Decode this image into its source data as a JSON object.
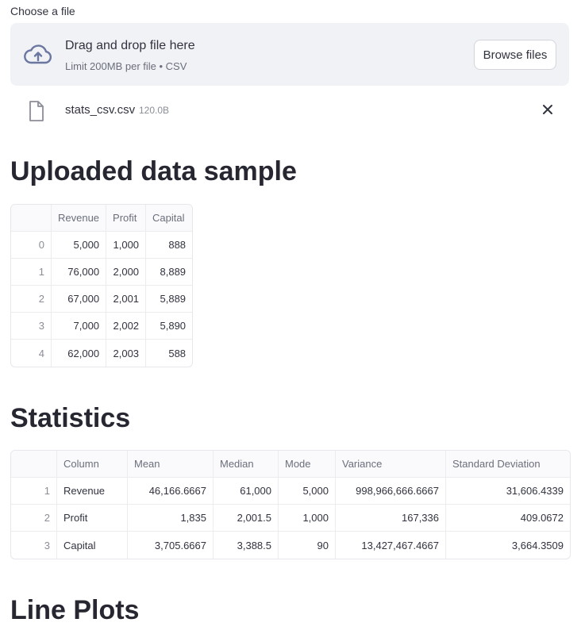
{
  "uploader": {
    "label": "Choose a file",
    "dropzone_title": "Drag and drop file here",
    "dropzone_subtitle": "Limit 200MB per file • CSV",
    "browse_label": "Browse files",
    "icon": "cloud-upload-icon"
  },
  "file": {
    "name": "stats_csv.csv",
    "size": "120.0B",
    "icon": "file-icon",
    "remove_icon": "close-icon"
  },
  "sample": {
    "heading": "Uploaded data sample",
    "columns": [
      "Revenue",
      "Profit",
      "Capital"
    ],
    "rows": [
      {
        "index": "0",
        "cells": [
          "5,000",
          "1,000",
          "888"
        ]
      },
      {
        "index": "1",
        "cells": [
          "76,000",
          "2,000",
          "8,889"
        ]
      },
      {
        "index": "2",
        "cells": [
          "67,000",
          "2,001",
          "5,889"
        ]
      },
      {
        "index": "3",
        "cells": [
          "7,000",
          "2,002",
          "5,890"
        ]
      },
      {
        "index": "4",
        "cells": [
          "62,000",
          "2,003",
          "588"
        ]
      }
    ]
  },
  "stats": {
    "heading": "Statistics",
    "columns": [
      "Column",
      "Mean",
      "Median",
      "Mode",
      "Variance",
      "Standard Deviation"
    ],
    "rows": [
      {
        "index": "1",
        "cells": [
          "Revenue",
          "46,166.6667",
          "61,000",
          "5,000",
          "998,966,666.6667",
          "31,606.4339"
        ]
      },
      {
        "index": "2",
        "cells": [
          "Profit",
          "1,835",
          "2,001.5",
          "1,000",
          "167,336",
          "409.0672"
        ]
      },
      {
        "index": "3",
        "cells": [
          "Capital",
          "3,705.6667",
          "3,388.5",
          "90",
          "13,427,467.4667",
          "3,664.3509"
        ]
      }
    ]
  },
  "line_plots": {
    "heading": "Line Plots"
  },
  "colors": {
    "dropzone_bg": "#f0f2f6",
    "text": "#31333f",
    "muted": "#6b6f7b"
  }
}
